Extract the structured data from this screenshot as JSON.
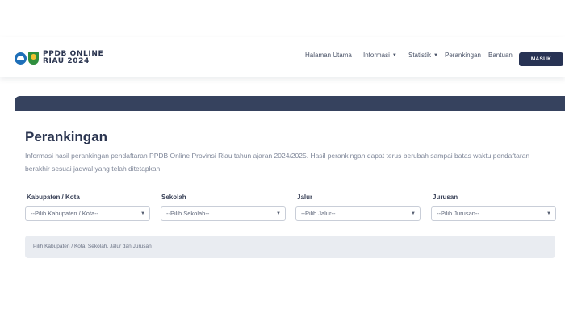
{
  "brand": {
    "line1": "PPDB ONLINE",
    "line2": "RIAU 2024"
  },
  "nav": {
    "home": "Halaman Utama",
    "info": "Informasi",
    "stats": "Statistik",
    "ranking": "Perankingan",
    "help": "Bantuan",
    "login": "MASUK"
  },
  "page": {
    "title": "Perankingan",
    "description": "Informasi hasil perankingan pendaftaran PPDB Online Provinsi Riau tahun ajaran 2024/2025. Hasil perankingan dapat terus berubah sampai batas waktu pendaftaran berakhir sesuai jadwal yang telah ditetapkan."
  },
  "filters": [
    {
      "label": "Kabupaten / Kota",
      "value": "--Pilih Kabupaten / Kota--"
    },
    {
      "label": "Sekolah",
      "value": "--Pilih Sekolah--"
    },
    {
      "label": "Jalur",
      "value": "--Pilih Jalur--"
    },
    {
      "label": "Jurusan",
      "value": "--Pilih Jurusan--"
    }
  ],
  "notice": "Pilih Kabupaten / Kota, Sekolah, Jalur dan Jurusan",
  "colors": {
    "primary": "#283354",
    "header_bar": "#36425e",
    "alert_bg": "#e9ecf1"
  }
}
